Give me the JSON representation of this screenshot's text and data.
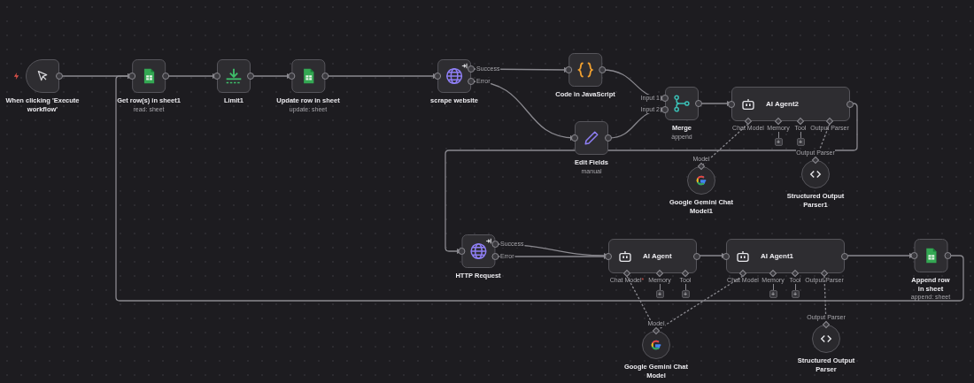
{
  "nodes": [
    {
      "kind": "manual_trigger",
      "title": "When clicking 'Execute workflow'"
    },
    {
      "kind": "google_sheets",
      "title": "Get row(s) in sheet1",
      "subtitle": "read: sheet"
    },
    {
      "kind": "limit",
      "title": "Limit1"
    },
    {
      "kind": "google_sheets",
      "title": "Update row in sheet",
      "subtitle": "update: sheet"
    },
    {
      "kind": "http",
      "title": "scrape website",
      "outputs": [
        "Success",
        "Error"
      ]
    },
    {
      "kind": "code",
      "title": "Code in JavaScript"
    },
    {
      "kind": "set",
      "title": "Edit Fields",
      "subtitle": "manual"
    },
    {
      "kind": "merge",
      "title": "Merge",
      "subtitle": "append",
      "inputs": [
        "Input 1",
        "Input 2"
      ]
    },
    {
      "kind": "agent",
      "title": "AI Agent2",
      "ports": [
        {
          "label": "Chat Model"
        },
        {
          "label": "Memory",
          "add": "+"
        },
        {
          "label": "Tool",
          "add": "+"
        },
        {
          "label": "Output Parser"
        }
      ]
    },
    {
      "kind": "gemini",
      "title": "Google Gemini Chat Model1",
      "input": "Model"
    },
    {
      "kind": "output_parser",
      "title": "Structured Output Parser1",
      "input": "Output Parser"
    },
    {
      "kind": "http",
      "title": "HTTP Request",
      "outputs": [
        "Success",
        "Error"
      ]
    },
    {
      "kind": "agent",
      "title": "AI Agent",
      "ports": [
        {
          "label": "Chat Model",
          "required_mark": "*"
        },
        {
          "label": "Memory",
          "add": "+"
        },
        {
          "label": "Tool",
          "add": "+"
        }
      ]
    },
    {
      "kind": "agent",
      "title": "AI Agent1",
      "ports": [
        {
          "label": "Chat Model"
        },
        {
          "label": "Memory",
          "add": "+"
        },
        {
          "label": "Tool",
          "add": "+"
        },
        {
          "label": "Output Parser"
        }
      ]
    },
    {
      "kind": "google_sheets",
      "title": "Append row in sheet",
      "subtitle": "append: sheet"
    },
    {
      "kind": "gemini",
      "title": "Google Gemini Chat Model",
      "input": "Model"
    },
    {
      "kind": "output_parser",
      "title": "Structured Output Parser",
      "input": "Output Parser"
    }
  ]
}
